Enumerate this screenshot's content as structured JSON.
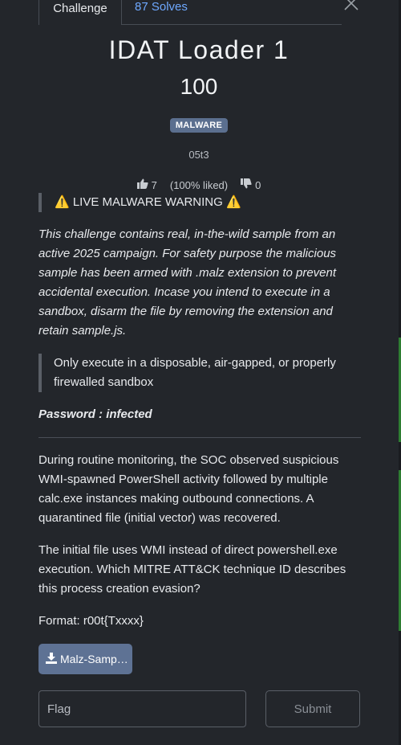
{
  "tabs": {
    "challenge_label": "Challenge",
    "solves_label": "87 Solves"
  },
  "challenge": {
    "title": "IDAT Loader 1",
    "value": "100",
    "category_badge": "MALWARE",
    "author": "05t3"
  },
  "rating": {
    "likes": "7",
    "liked_percent": "(100% liked)",
    "dislikes": "0"
  },
  "description": {
    "warning": "⚠️ LIVE MALWARE WARNING ⚠️",
    "intro": "This challenge contains real, in-the-wild sample from an active 2025 campaign. For safety purpose the malicious sample has been armed with .malz extension to prevent accidental execution. Incase you intend to execute in a sandbox, disarm the file by removing the extension and retain sample.js.",
    "quote": "Only execute in a disposable, air-gapped, or properly firewalled sandbox",
    "password": "Password : infected",
    "scenario": "During routine monitoring, the SOC observed suspicious WMI-spawned PowerShell activity followed by multiple calc.exe instances making outbound connections. A quarantined file (initial vector) was recovered.",
    "question": "The initial file uses WMI instead of direct powershell.exe execution. Which MITRE ATT&CK technique ID describes this process creation evasion?",
    "format": "Format: r00t{Txxxx}"
  },
  "files": {
    "download_label": "Malz-Samp…"
  },
  "submission": {
    "flag_placeholder": "Flag",
    "submit_label": "Submit"
  },
  "icons": {
    "close": "close-icon",
    "thumbs_up": "thumbs-up-icon",
    "thumbs_down": "thumbs-down-icon",
    "download": "download-icon"
  },
  "colors": {
    "background": "#23262b",
    "link": "#6ea8fe",
    "badge": "#5b6f8f",
    "download_button": "#5e7294"
  }
}
